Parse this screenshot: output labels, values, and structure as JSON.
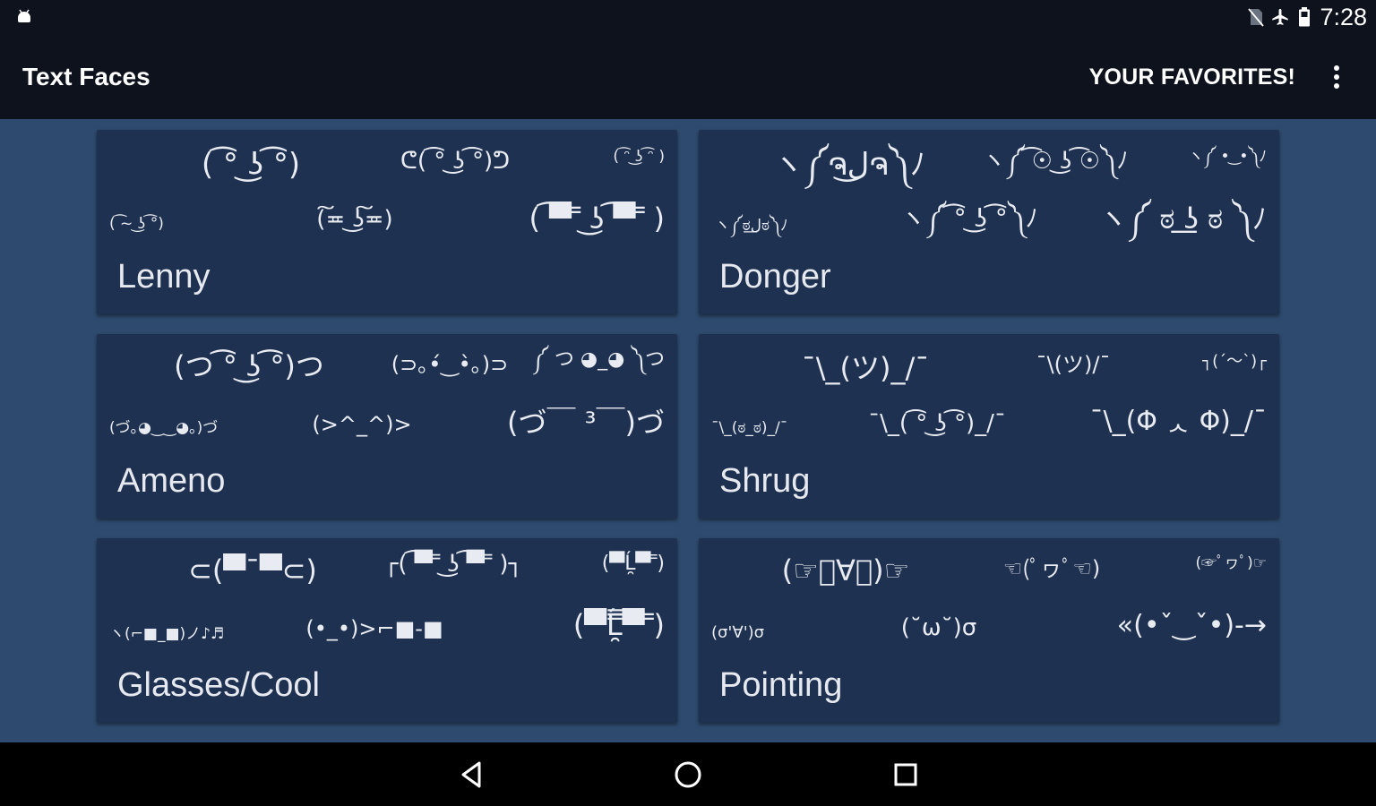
{
  "status_bar": {
    "left_icon": "android-notification-icon",
    "icons": [
      "no-sim-icon",
      "airplane-mode-icon",
      "battery-icon"
    ],
    "time": "7:28"
  },
  "app_bar": {
    "title": "Text Faces",
    "favorites_label": "YOUR FAVORITES!",
    "menu_icon": "overflow-menu-icon"
  },
  "categories": [
    {
      "label": "Lenny",
      "faces": [
        "( ͡° ͜ʖ ͡°)",
        "ᕦ( ͡° ͜ʖ ͡°)ᕤ",
        "( ͡ᵔ ͜ʖ ͡ᵔ )",
        "( ͡~ ͜ʖ ͡°)",
        "(͠≖ ͜ʖ͠≖)",
        "( ͡▀̿ ̿ ͜ʖ ͡▀̿ ̿ )"
      ]
    },
    {
      "label": "Donger",
      "faces": [
        "ヽ༼ຈل͜ຈ༽ﾉ",
        "ヽ༼ ͡☉ ͜ʖ ͡☉༽ﾉ",
        "ヽ༼ • ͜ •༽ﾉ",
        "ヽ༼ಠل͟ಠ༽ﾉ",
        "ヽ༼ ͡° ͜ʖ ͡°༽ﾉ",
        "ヽ༼ ಠ ͟ʖ ಠ ༽ﾉ"
      ]
    },
    {
      "label": "Ameno",
      "faces": [
        "(つ ͡° ͜ʖ ͡°)つ",
        "(⊃｡•́‿•̀｡)⊃",
        "༼ つ ◕_◕ ༽つ",
        "(づ｡◕‿‿◕｡)づ",
        "(>^_^)>",
        "(づ￣ ³￣)づ"
      ]
    },
    {
      "label": "Shrug",
      "faces": [
        "¯\\_(ツ)_/¯",
        "¯\\(ツ)/¯",
        "┐(´～`)┌",
        "¯\\_(ಠ_ಠ)_/¯",
        "¯\\_( ͡° ͜ʖ ͡°)_/¯",
        "¯\\_(Φ ᆺ Φ)_/¯"
      ]
    },
    {
      "label": "Glasses/Cool",
      "faces": [
        "⊂(▀¯▀⊂)",
        "┌( ͡▀̿ ̿ ͜ʖ ͡▀̿ ̿ )┐",
        "(▀̿Ĺ̯▀̿ ̿)",
        "ヽ(⌐■_■)ノ♪♬",
        "(•_•)>⌐■-■",
        "(▀̿̿Ĺ̯̿̿▀̿ ̿)"
      ]
    },
    {
      "label": "Pointing",
      "faces": [
        "(☞ﾟ∀ﾟ)☞",
        "☜(ﾟヮﾟ☜)",
        "(☞ﾟヮﾟ)☞",
        "(σ'∀')σ",
        "(˘ω˘)σ",
        "«(•ˇ‿ˇ•)-→"
      ]
    }
  ],
  "nav_bar": {
    "buttons": [
      "back-icon",
      "home-icon",
      "recents-icon"
    ]
  }
}
